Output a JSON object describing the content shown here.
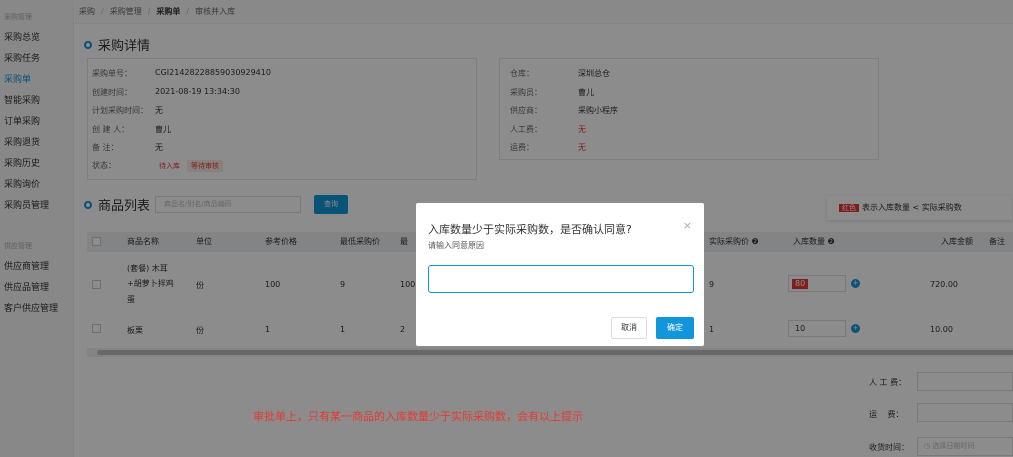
{
  "sidebar": {
    "group1": "采购管理",
    "items": [
      "采购总览",
      "采购任务",
      "采购单",
      "智能采购",
      "订单采购",
      "采购退货",
      "采购历史",
      "采购询价",
      "采购员管理"
    ],
    "group2": "供应管理",
    "items2": [
      "供应商管理",
      "供应品管理",
      "客户供应管理"
    ]
  },
  "breadcrumb": {
    "items": [
      "采购",
      "采购管理",
      "采购单",
      "审核并入库"
    ],
    "sep": "/"
  },
  "detail": {
    "title": "采购详情",
    "left": [
      {
        "label": "采购单号：",
        "value": "CGI21428228859030929410"
      },
      {
        "label": "创建时间：",
        "value": "2021-08-19 13:34:30"
      },
      {
        "label": "计划采购时间：",
        "value": "无"
      },
      {
        "label": "创 建 人：",
        "value": "曹儿"
      },
      {
        "label": "备    注：",
        "value": "无"
      },
      {
        "label": "状态：",
        "badge1": "待入库",
        "badge2": "等待审核"
      }
    ],
    "right": [
      {
        "label": "仓库：",
        "value": "深圳总仓"
      },
      {
        "label": "采购员：",
        "value": "曹儿"
      },
      {
        "label": "供应商：",
        "value": "采购小程序"
      },
      {
        "label": "人工费：",
        "value": "无"
      },
      {
        "label": "运费：",
        "value": "无"
      }
    ]
  },
  "goods": {
    "title": "商品列表",
    "search_placeholder": "商品名/别名/商品编码",
    "query_label": "查询",
    "headers": {
      "name": "商品名称",
      "unit": "单位",
      "ref_price": "参考价格",
      "min_price": "最低采购价",
      "max_price": "最",
      "actual_price": "实际采购价",
      "in_qty": "入库数量",
      "in_amount": "入库金额",
      "remark": "备注"
    },
    "rows": [
      {
        "name_line1": "(套餐) 木耳",
        "name_line2": "+胡萝卜拌鸡",
        "name_line3": "蛋",
        "unit": "份",
        "ref_price": "100",
        "min_price": "9",
        "max_price": "100",
        "actual_price": "9",
        "in_qty": "80",
        "in_amount": "720.00"
      },
      {
        "name_line1": "板栗",
        "unit": "份",
        "ref_price": "1",
        "min_price": "1",
        "max_price": "2",
        "actual_price": "1",
        "in_qty": "10",
        "in_amount": "10.00"
      }
    ]
  },
  "legend": {
    "tag": "红色",
    "text": "表示入库数量 < 实际采购数"
  },
  "form": {
    "labor_label": "人 工 费：",
    "freight_label": "运　 费：",
    "receive_label": "收货时间：",
    "receive_placeholder": "选择日期时间"
  },
  "caption": "审批单上，只有某一商品的入库数量少于实际采购数，会有以上提示",
  "dialog": {
    "title": "入库数量少于实际采购数，是否确认同意?",
    "subtitle": "请输入同意原因",
    "cancel_label": "取消",
    "ok_label": "确定"
  }
}
